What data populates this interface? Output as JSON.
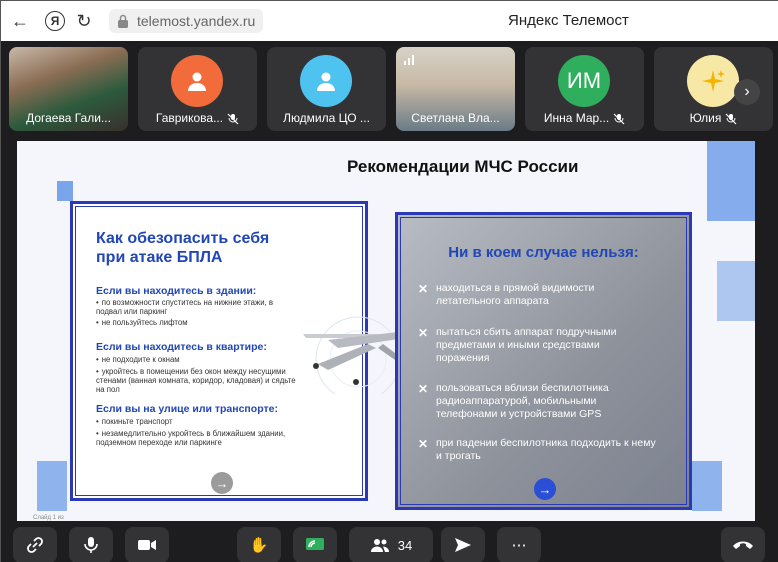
{
  "browser": {
    "url": "telemost.yandex.ru",
    "title": "Яндекс Телемост"
  },
  "participants": [
    {
      "name": "Догаева Гали...",
      "kind": "photo",
      "muted": false
    },
    {
      "name": "Гаврикова...",
      "kind": "avatar",
      "avatar_color": "#f26b3a",
      "muted": true
    },
    {
      "name": "Людмила ЦО ...",
      "kind": "avatar",
      "avatar_color": "#4fc3ef",
      "muted": false
    },
    {
      "name": "Светлана Вла...",
      "kind": "photo",
      "muted": false
    },
    {
      "name": "Инна Мар...",
      "kind": "initials",
      "initials": "ИМ",
      "avatar_color": "#2fae5d",
      "muted": true
    },
    {
      "name": "Юлия",
      "kind": "emoji",
      "avatar_color": "#f7e8a5",
      "muted": true
    }
  ],
  "slide": {
    "title": "Рекомендации МЧС России",
    "left": {
      "heading": "Как обезопасить себя при атаке БПЛА",
      "sections": [
        {
          "title": "Если вы находитесь в здании:",
          "items": [
            "по возможности спуститесь на нижние этажи, в подвал или паркинг",
            "не пользуйтесь лифтом"
          ]
        },
        {
          "title": "Если вы находитесь в квартире:",
          "items": [
            "не подходите к окнам",
            "укройтесь в помещении без окон между несущими стенами (ванная комната, коридор, кладовая) и сядьте на пол"
          ]
        },
        {
          "title": "Если вы на улице или транспорте:",
          "items": [
            "покиньте транспорт",
            "незамедлительно укройтесь в ближайшем здании, подземном переходе или паркинге"
          ]
        }
      ]
    },
    "right": {
      "heading": "Ни в коем случае нельзя:",
      "items": [
        "находиться в прямой видимости летательного аппарата",
        "пытаться сбить аппарат подручными предметами и иными средствами поражения",
        "пользоваться вблизи беспилотника радиоаппаратурой, мобильными телефонами и устройствами GPS",
        "при падении беспилотника подходить к нему и трогать"
      ]
    },
    "footer": "Слайд 1 из"
  },
  "toolbar": {
    "participants_count": "34"
  },
  "colors": {
    "accent_blue": "#2146b5",
    "hangup_bg": "#333336",
    "screen_share": "#2fae5d"
  }
}
